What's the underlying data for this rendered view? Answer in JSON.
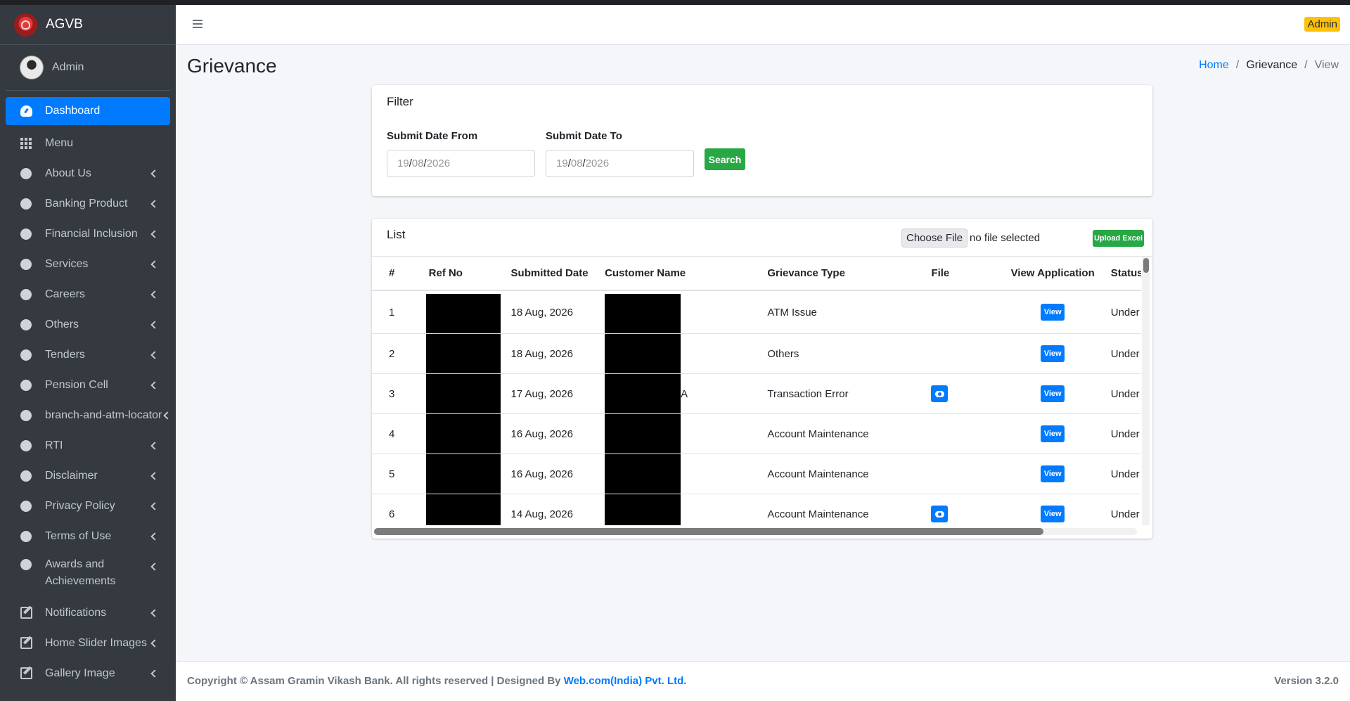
{
  "app": {
    "brand": "AGVB",
    "user": "Admin",
    "admin_badge": "Admin"
  },
  "sidebar": {
    "items": [
      {
        "label": "Dashboard",
        "icon": "dashboard-icon",
        "active": true
      },
      {
        "label": "Menu",
        "icon": "grid-icon"
      },
      {
        "label": "About Us",
        "icon": "circle-icon"
      },
      {
        "label": "Banking Product",
        "icon": "circle-icon"
      },
      {
        "label": "Financial Inclusion",
        "icon": "circle-icon"
      },
      {
        "label": "Services",
        "icon": "circle-icon"
      },
      {
        "label": "Careers",
        "icon": "circle-icon"
      },
      {
        "label": "Others",
        "icon": "circle-icon"
      },
      {
        "label": "Tenders",
        "icon": "circle-icon"
      },
      {
        "label": "Pension Cell",
        "icon": "circle-icon"
      },
      {
        "label": "branch-and-atm-locator",
        "icon": "circle-icon"
      },
      {
        "label": "RTI",
        "icon": "circle-icon"
      },
      {
        "label": "Disclaimer",
        "icon": "circle-icon"
      },
      {
        "label": "Privacy Policy",
        "icon": "circle-icon"
      },
      {
        "label": "Terms of Use",
        "icon": "circle-icon"
      },
      {
        "label": "Awards and Achievements",
        "icon": "circle-icon"
      },
      {
        "label": "Notifications",
        "icon": "edit-icon"
      },
      {
        "label": "Home Slider Images",
        "icon": "edit-icon"
      },
      {
        "label": "Gallery Image",
        "icon": "edit-icon"
      }
    ]
  },
  "page": {
    "title": "Grievance",
    "breadcrumb": {
      "home": "Home",
      "section": "Grievance",
      "current": "View"
    }
  },
  "filter": {
    "title": "Filter",
    "from_label": "Submit Date From",
    "to_label": "Submit Date To",
    "from_value": {
      "dd": "19",
      "mm": "08",
      "yyyy": "2026"
    },
    "to_value": {
      "dd": "19",
      "mm": "08",
      "yyyy": "2026"
    },
    "search_label": "Search"
  },
  "list": {
    "title": "List",
    "choose_file_label": "Choose File",
    "no_file_text": "no file selected",
    "upload_label": "Upload Excel",
    "columns": [
      "#",
      "Ref No",
      "Submitted Date",
      "Customer Name",
      "Grievance Type",
      "File",
      "View Application",
      "Status"
    ],
    "rows": [
      {
        "num": "1",
        "date": "18 Aug, 2026",
        "name_visible": "",
        "type": "ATM Issue",
        "has_file": false,
        "view": "View",
        "status": "Under Process"
      },
      {
        "num": "2",
        "date": "18 Aug, 2026",
        "name_visible": "",
        "type": "Others",
        "has_file": false,
        "view": "View",
        "status": "Under Process"
      },
      {
        "num": "3",
        "date": "17 Aug, 2026",
        "name_visible": "A",
        "type": "Transaction Error",
        "has_file": true,
        "view": "View",
        "status": "Under Process"
      },
      {
        "num": "4",
        "date": "16 Aug, 2026",
        "name_visible": "",
        "type": "Account Maintenance",
        "has_file": false,
        "view": "View",
        "status": "Under Process"
      },
      {
        "num": "5",
        "date": "16 Aug, 2026",
        "name_visible": "",
        "type": "Account Maintenance",
        "has_file": false,
        "view": "View",
        "status": "Under Process"
      },
      {
        "num": "6",
        "date": "14 Aug, 2026",
        "name_visible": "",
        "type": "Account Maintenance",
        "has_file": true,
        "view": "View",
        "status": "Under Process"
      }
    ]
  },
  "footer": {
    "copyright": "Copyright © Assam Gramin Vikash Bank. All rights reserved | Designed By ",
    "designer": "Web.com(India) Pvt. Ltd.",
    "version": "Version 3.2.0"
  },
  "colors": {
    "accent": "#007bff",
    "success": "#28a745",
    "sidebar_bg": "#343a40",
    "badge": "#ffc107"
  }
}
